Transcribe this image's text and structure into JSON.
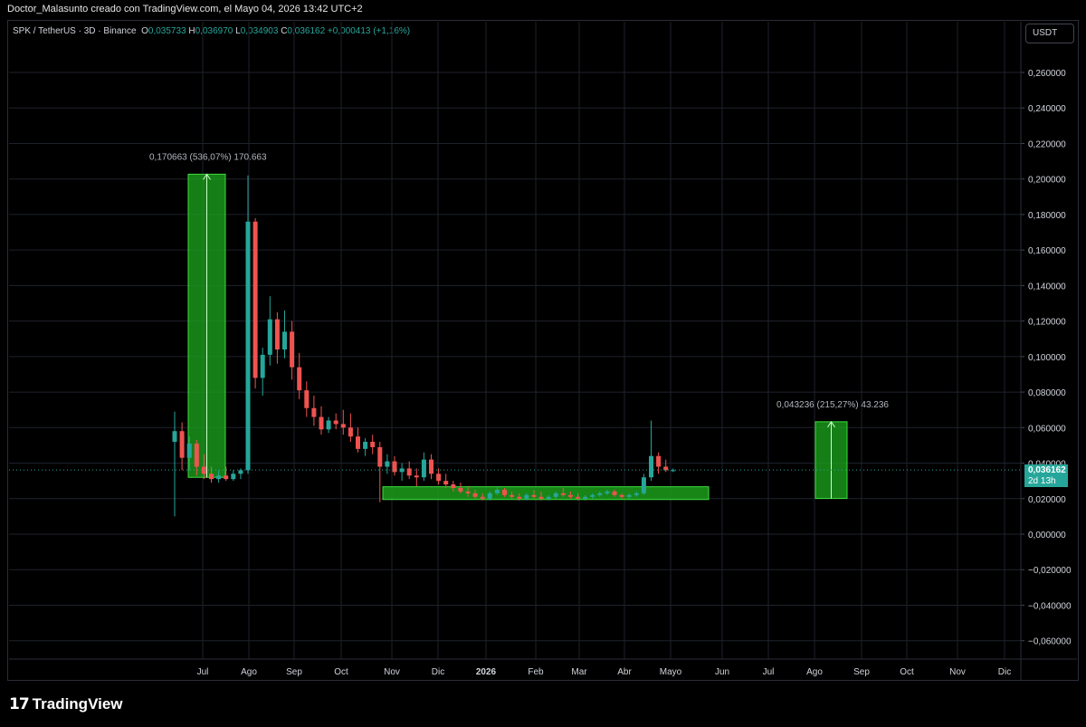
{
  "caption": "Doctor_Malasunto creado con TradingView.com, el Mayo 04, 2026 13:42 UTC+2",
  "symbol": {
    "name": "SPK / TetherUS · 3D · Binance",
    "open_label": "O",
    "open": "0,035733",
    "high_label": "H",
    "high": "0,036970",
    "low_label": "L",
    "low": "0,034903",
    "close_label": "C",
    "close": "0,036162",
    "change": "+0,000413 (+1,16%)"
  },
  "currency": "USDT",
  "current_price": {
    "price": "0,036162",
    "countdown": "2d 13h"
  },
  "brand": "TradingView",
  "colors": {
    "up": "#26a69a",
    "down": "#ef5350",
    "zone": "#1b9e1b",
    "zone_stroke": "#3ddc3d",
    "grid": "#1e222d"
  },
  "chart_data": {
    "type": "candlestick",
    "yaxis_labels": [
      "0,260000",
      "0,240000",
      "0,220000",
      "0,200000",
      "0,180000",
      "0,160000",
      "0,140000",
      "0,120000",
      "0,100000",
      "0,080000",
      "0,060000",
      "0,040000",
      "0,020000",
      "0,000000",
      "−0,020000",
      "−0,040000",
      "−0,060000"
    ],
    "xaxis_labels": [
      "Jul",
      "Ago",
      "Sep",
      "Oct",
      "Nov",
      "Dic",
      "2026",
      "Feb",
      "Mar",
      "Abr",
      "Mayo",
      "Jun",
      "Jul",
      "Ago",
      "Sep",
      "Oct",
      "Nov",
      "Dic"
    ],
    "ylim": [
      -0.07,
      0.275
    ],
    "annotations": [
      {
        "text": "0,170663 (536,07%) 170.663",
        "from": 0.032,
        "to": 0.2027
      },
      {
        "text": "0,043236 (215,27%) 43.236",
        "from": 0.0201,
        "to": 0.0633
      }
    ],
    "support_zone": {
      "from": 0.0195,
      "to": 0.0267
    },
    "last_price": 0.036162,
    "candles": [
      [
        0.052,
        0.069,
        0.01,
        0.058
      ],
      [
        0.058,
        0.063,
        0.036,
        0.043
      ],
      [
        0.043,
        0.055,
        0.036,
        0.051
      ],
      [
        0.051,
        0.053,
        0.033,
        0.038
      ],
      [
        0.038,
        0.045,
        0.031,
        0.034
      ],
      [
        0.034,
        0.038,
        0.029,
        0.031
      ],
      [
        0.031,
        0.036,
        0.029,
        0.033
      ],
      [
        0.033,
        0.038,
        0.03,
        0.031
      ],
      [
        0.031,
        0.036,
        0.03,
        0.034
      ],
      [
        0.034,
        0.037,
        0.031,
        0.036
      ],
      [
        0.036,
        0.202,
        0.034,
        0.176
      ],
      [
        0.176,
        0.178,
        0.082,
        0.088
      ],
      [
        0.088,
        0.105,
        0.078,
        0.101
      ],
      [
        0.101,
        0.134,
        0.095,
        0.121
      ],
      [
        0.121,
        0.125,
        0.096,
        0.104
      ],
      [
        0.104,
        0.126,
        0.099,
        0.114
      ],
      [
        0.114,
        0.12,
        0.087,
        0.094
      ],
      [
        0.094,
        0.102,
        0.076,
        0.081
      ],
      [
        0.081,
        0.086,
        0.066,
        0.071
      ],
      [
        0.071,
        0.078,
        0.061,
        0.066
      ],
      [
        0.066,
        0.072,
        0.056,
        0.059
      ],
      [
        0.059,
        0.066,
        0.057,
        0.064
      ],
      [
        0.064,
        0.068,
        0.059,
        0.062
      ],
      [
        0.062,
        0.07,
        0.056,
        0.06
      ],
      [
        0.06,
        0.068,
        0.052,
        0.055
      ],
      [
        0.055,
        0.06,
        0.046,
        0.048
      ],
      [
        0.048,
        0.054,
        0.044,
        0.052
      ],
      [
        0.052,
        0.056,
        0.045,
        0.049
      ],
      [
        0.049,
        0.052,
        0.018,
        0.038
      ],
      [
        0.038,
        0.045,
        0.034,
        0.041
      ],
      [
        0.041,
        0.044,
        0.033,
        0.035
      ],
      [
        0.035,
        0.04,
        0.03,
        0.037
      ],
      [
        0.037,
        0.041,
        0.031,
        0.033
      ],
      [
        0.033,
        0.037,
        0.027,
        0.032
      ],
      [
        0.032,
        0.046,
        0.03,
        0.042
      ],
      [
        0.042,
        0.045,
        0.031,
        0.034
      ],
      [
        0.034,
        0.037,
        0.028,
        0.03
      ],
      [
        0.03,
        0.034,
        0.026,
        0.028
      ],
      [
        0.028,
        0.03,
        0.024,
        0.026
      ],
      [
        0.026,
        0.029,
        0.023,
        0.024
      ],
      [
        0.024,
        0.027,
        0.021,
        0.023
      ],
      [
        0.023,
        0.025,
        0.02,
        0.021
      ],
      [
        0.021,
        0.023,
        0.019,
        0.02
      ],
      [
        0.02,
        0.024,
        0.019,
        0.023
      ],
      [
        0.023,
        0.027,
        0.022,
        0.025
      ],
      [
        0.025,
        0.026,
        0.021,
        0.022
      ],
      [
        0.022,
        0.024,
        0.02,
        0.021
      ],
      [
        0.021,
        0.023,
        0.019,
        0.02
      ],
      [
        0.02,
        0.023,
        0.019,
        0.022
      ],
      [
        0.022,
        0.025,
        0.02,
        0.021
      ],
      [
        0.021,
        0.024,
        0.019,
        0.02
      ],
      [
        0.02,
        0.022,
        0.019,
        0.021
      ],
      [
        0.021,
        0.024,
        0.02,
        0.023
      ],
      [
        0.023,
        0.026,
        0.021,
        0.022
      ],
      [
        0.022,
        0.024,
        0.02,
        0.021
      ],
      [
        0.021,
        0.023,
        0.019,
        0.02
      ],
      [
        0.02,
        0.022,
        0.019,
        0.021
      ],
      [
        0.021,
        0.023,
        0.02,
        0.022
      ],
      [
        0.022,
        0.024,
        0.021,
        0.023
      ],
      [
        0.023,
        0.025,
        0.022,
        0.024
      ],
      [
        0.024,
        0.025,
        0.021,
        0.022
      ],
      [
        0.022,
        0.023,
        0.02,
        0.021
      ],
      [
        0.021,
        0.023,
        0.02,
        0.022
      ],
      [
        0.022,
        0.024,
        0.021,
        0.023
      ],
      [
        0.023,
        0.034,
        0.022,
        0.032
      ],
      [
        0.032,
        0.064,
        0.03,
        0.044
      ],
      [
        0.044,
        0.046,
        0.034,
        0.038
      ],
      [
        0.038,
        0.042,
        0.035,
        0.036
      ],
      [
        0.036,
        0.037,
        0.035,
        0.036
      ]
    ]
  }
}
